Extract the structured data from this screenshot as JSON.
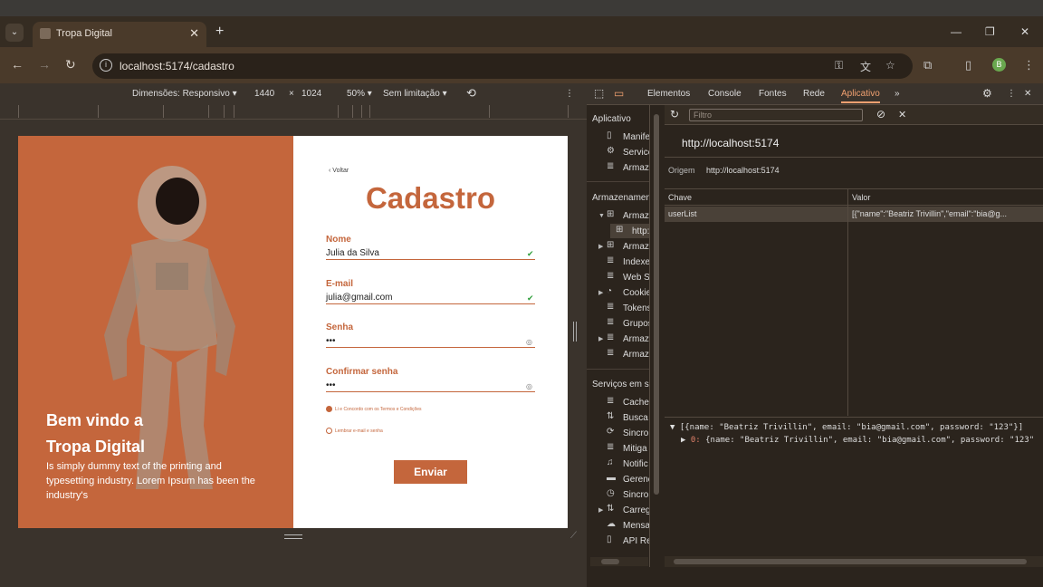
{
  "browser": {
    "tab_title": "Tropa Digital",
    "url": "localhost:5174/cadastro"
  },
  "device_toolbar": {
    "dimensions_label": "Dimensões: Responsivo",
    "width": "1440",
    "height": "1024",
    "zoom": "50%",
    "throttle": "Sem limitação"
  },
  "page": {
    "hero_title_line1": "Bem vindo a",
    "hero_title_line2": "Tropa Digital",
    "hero_text": "Is simply dummy text of the printing and typesetting industry. Lorem Ipsum has been the industry's",
    "back_label": "Voltar",
    "form_title": "Cadastro",
    "fields": [
      {
        "label": "Nome",
        "value": "Julia da Silva"
      },
      {
        "label": "E-mail",
        "value": "julia@gmail.com"
      },
      {
        "label": "Senha",
        "value": "•••"
      },
      {
        "label": "Confirmar senha",
        "value": "•••"
      }
    ],
    "option1": "Li e Concordo com os Termos e Condições",
    "option2": "Lembrar e-mail e senha",
    "submit_label": "Enviar"
  },
  "devtools": {
    "tabs": [
      "Elementos",
      "Console",
      "Fontes",
      "Rede",
      "Aplicativo"
    ],
    "active_tab": "Aplicativo",
    "sidebar": {
      "section1": "Aplicativo",
      "items1": [
        "Manife",
        "Service",
        "Armaz"
      ],
      "section2": "Armazenament",
      "items2": [
        "Armaz",
        "http:",
        "Armaz",
        "Indexe",
        "Web S",
        "Cookie",
        "Tokens",
        "Grupos",
        "Armaz",
        "Armaz"
      ],
      "section3": "Serviços em s",
      "items3": [
        "Cache",
        "Busca",
        "Sincro",
        "Mitiga",
        "Notific",
        "Gerenc",
        "Sincro",
        "Carreg",
        "Mensa",
        "API Re"
      ]
    },
    "filter_placeholder": "Filtro",
    "origin_title": "http://localhost:5174",
    "origin_label": "Origem",
    "origin_value": "http://localhost:5174",
    "table": {
      "col_key": "Chave",
      "col_value": "Valor",
      "row_key": "userList",
      "row_value": "[{\"name\":\"Beatriz Trivillin\",\"email\":\"bia@g..."
    },
    "console_line1": "[{name: \"Beatriz Trivillin\", email: \"bia@gmail.com\", password: \"123\"}]",
    "console_line2_idx": "0:",
    "console_line2": "{name: \"Beatriz Trivillin\", email: \"bia@gmail.com\", password: \"123\""
  }
}
